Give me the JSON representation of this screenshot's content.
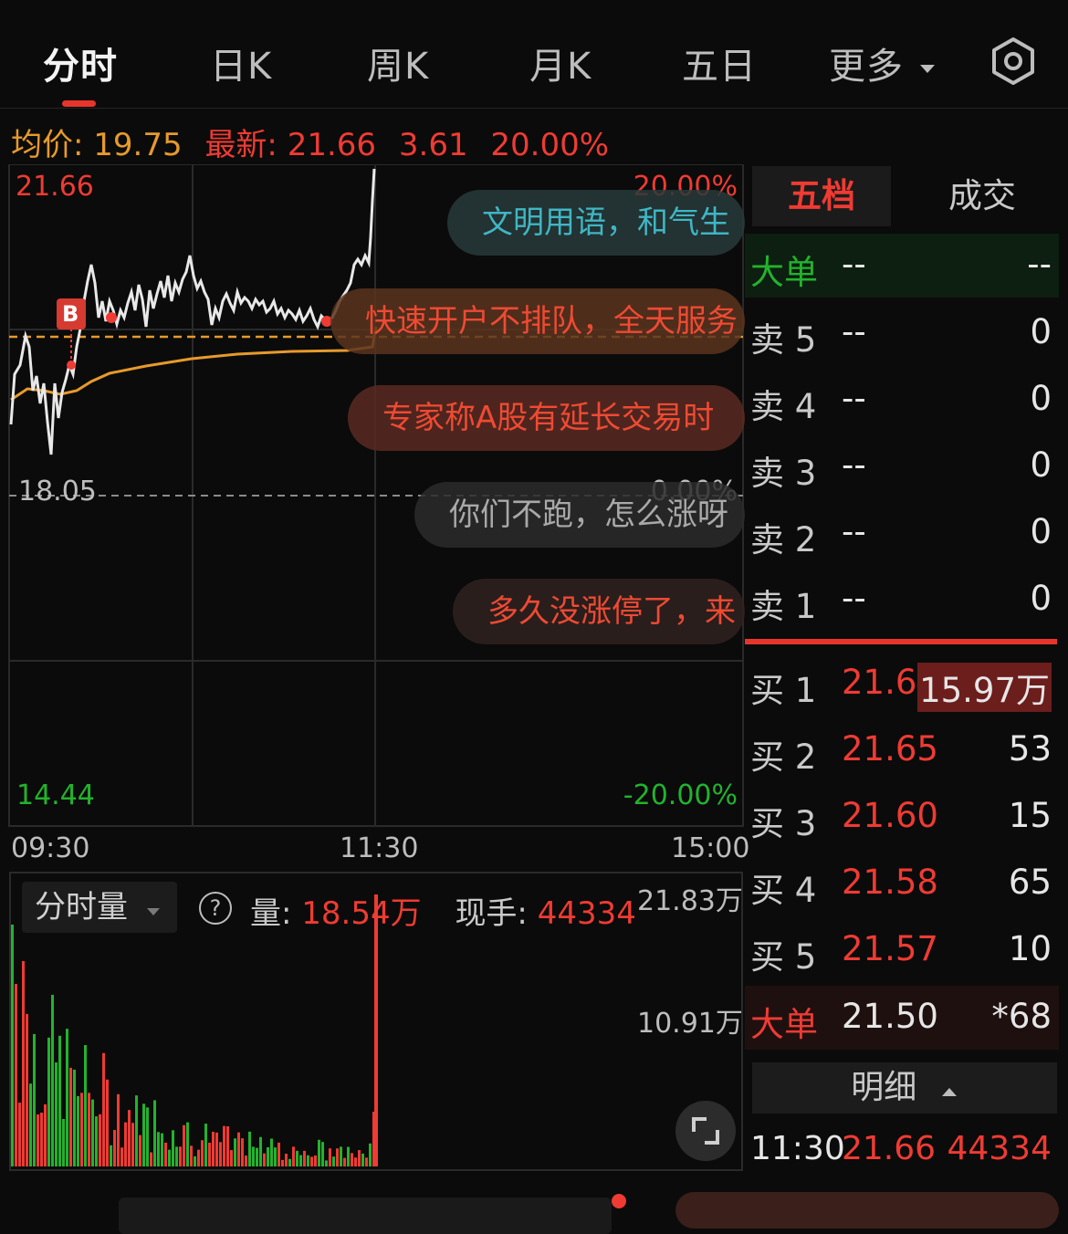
{
  "tabs": [
    "分时",
    "日K",
    "周K",
    "月K",
    "五日",
    "更多"
  ],
  "info": {
    "avg_label": "均价:",
    "avg": "19.75",
    "latest_label": "最新:",
    "latest": "21.66",
    "change": "3.61",
    "pct": "20.00%"
  },
  "chart": {
    "price_high": "21.66",
    "pct_high": "20.00%",
    "price_mid": "18.05",
    "pct_mid": "0.00%",
    "price_low": "14.44",
    "pct_low": "-20.00%",
    "times": [
      "09:30",
      "11:30",
      "15:00"
    ],
    "marker": "B",
    "bubbles": [
      "文明用语，和气生",
      "快速开户不排队，全天服务",
      "专家称A股有延长交易时",
      "你们不跑，怎么涨呀",
      "多久没涨停了，来"
    ]
  },
  "volume": {
    "selector": "分时量",
    "help": "?",
    "vol_label": "量:",
    "vol": "18.54万",
    "hand_label": "现手:",
    "hand": "44334",
    "scale_top": "21.83万",
    "scale_mid": "10.91万"
  },
  "book": {
    "tabs": [
      "五档",
      "成交"
    ],
    "big_top": {
      "label": "大单",
      "mid": "--",
      "right": "--"
    },
    "asks": [
      {
        "label": "卖 5",
        "price": "--",
        "vol": "0"
      },
      {
        "label": "卖 4",
        "price": "--",
        "vol": "0"
      },
      {
        "label": "卖 3",
        "price": "--",
        "vol": "0"
      },
      {
        "label": "卖 2",
        "price": "--",
        "vol": "0"
      },
      {
        "label": "卖 1",
        "price": "--",
        "vol": "0"
      }
    ],
    "bids": [
      {
        "label": "买 1",
        "price": "21.66",
        "vol": "15.97万"
      },
      {
        "label": "买 2",
        "price": "21.65",
        "vol": "53"
      },
      {
        "label": "买 3",
        "price": "21.60",
        "vol": "15"
      },
      {
        "label": "买 4",
        "price": "21.58",
        "vol": "65"
      },
      {
        "label": "买 5",
        "price": "21.57",
        "vol": "10"
      }
    ],
    "big_bottom": {
      "label": "大单",
      "price": "21.50",
      "vol": "*68"
    },
    "detail_label": "明细",
    "trade": {
      "time": "11:30",
      "price": "21.66",
      "vol": "44334"
    }
  },
  "colors": {
    "up": "#ef3b33",
    "down": "#22b32d",
    "avg": "#e79a2b",
    "price_line": "#e8e8e8"
  }
}
